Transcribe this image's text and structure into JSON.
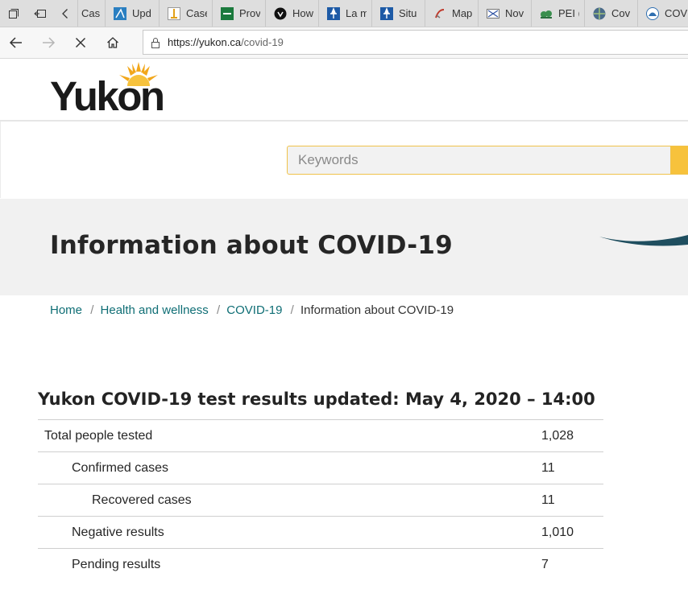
{
  "browser": {
    "tabs": [
      {
        "label": "Case",
        "icon": "generic-page-icon"
      },
      {
        "label": "Upd",
        "icon": "alberta-icon"
      },
      {
        "label": "Case",
        "icon": "bc-icon"
      },
      {
        "label": "Prov",
        "icon": "saskatchewan-icon"
      },
      {
        "label": "How",
        "icon": "ontario-icon"
      },
      {
        "label": "La m",
        "icon": "quebec-fleur-icon"
      },
      {
        "label": "Situ",
        "icon": "quebec-fleur-icon"
      },
      {
        "label": "Map",
        "icon": "nb-icon"
      },
      {
        "label": "Nov",
        "icon": "ns-icon"
      },
      {
        "label": "PEI (",
        "icon": "pei-icon"
      },
      {
        "label": "Cov",
        "icon": "globe-icon"
      },
      {
        "label": "COV",
        "icon": "nl-icon"
      }
    ],
    "url_host": "https://yukon.ca",
    "url_path": "/covid-19"
  },
  "header": {
    "logo_text": "Yukon"
  },
  "search": {
    "placeholder": "Keywords"
  },
  "hero": {
    "title": "Information about COVID-19"
  },
  "breadcrumb": {
    "items": [
      "Home",
      "Health and wellness",
      "COVID-19"
    ],
    "current": "Information about COVID-19",
    "separator": "/"
  },
  "results": {
    "title": "Yukon COVID-19 test results updated: May 4, 2020 – 14:00",
    "rows": [
      {
        "label": "Total people tested",
        "value": "1,028"
      },
      {
        "label": "Confirmed cases",
        "value": "11"
      },
      {
        "label": "Recovered cases",
        "value": "11"
      },
      {
        "label": "Negative results",
        "value": "1,010"
      },
      {
        "label": "Pending results",
        "value": "7"
      }
    ]
  },
  "colors": {
    "link": "#0f6e75",
    "accent": "#f7c23c",
    "hero_bg": "#f1f1f1"
  }
}
